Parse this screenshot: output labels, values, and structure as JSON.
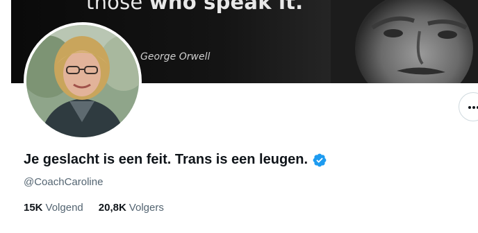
{
  "banner": {
    "quote_light": "those",
    "quote_bold": "who speak it.",
    "author": "George Orwell"
  },
  "profile": {
    "display_name": "Je geslacht is een feit. Trans is een leugen.",
    "handle": "@CoachCaroline",
    "verified_color": "#1d9bf0"
  },
  "stats": {
    "following_count": "15K",
    "following_label": "Volgend",
    "followers_count": "20,8K",
    "followers_label": "Volgers"
  },
  "icons": {
    "verified": "verified-badge-icon",
    "more": "more-options-icon"
  }
}
